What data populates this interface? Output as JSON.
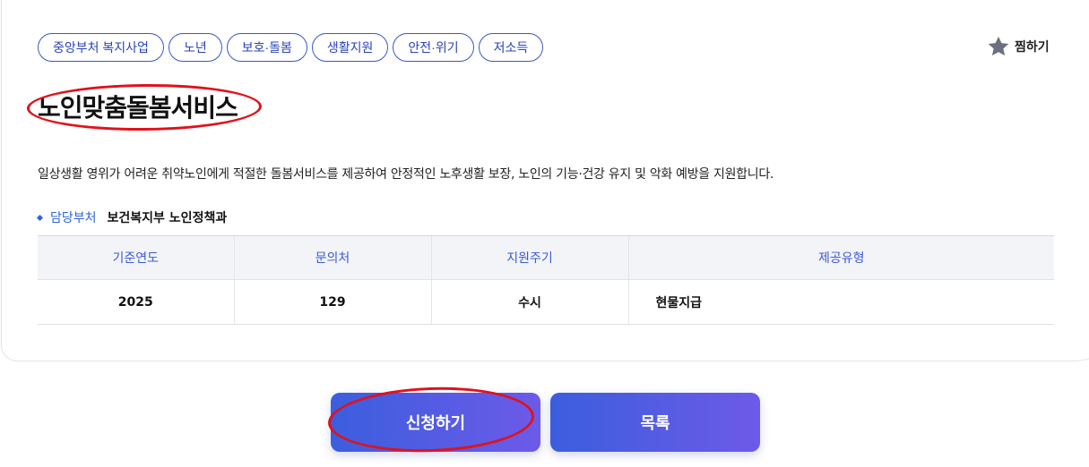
{
  "tags": [
    "중앙부처 복지사업",
    "노년",
    "보호·돌봄",
    "생활지원",
    "안전·위기",
    "저소득"
  ],
  "wishlist_label": "찜하기",
  "title": "노인맞춤돌봄서비스",
  "description": "일상생활 영위가 어려운 취약노인에게 적절한 돌봄서비스를 제공하여 안정적인 노후생활 보장, 노인의 기능·건강 유지 및 악화 예방을 지원합니다.",
  "department": {
    "label": "담당부처",
    "value": "보건복지부 노인정책과"
  },
  "table": {
    "headers": [
      "기준연도",
      "문의처",
      "지원주기",
      "제공유형"
    ],
    "row": [
      "2025",
      "129",
      "수시",
      "현물지급"
    ]
  },
  "buttons": {
    "apply": "신청하기",
    "list": "목록"
  },
  "colors": {
    "accent": "#3a57c7",
    "highlight": "#e0121b",
    "button_start": "#3b5ede",
    "button_end": "#6d5ae8"
  }
}
